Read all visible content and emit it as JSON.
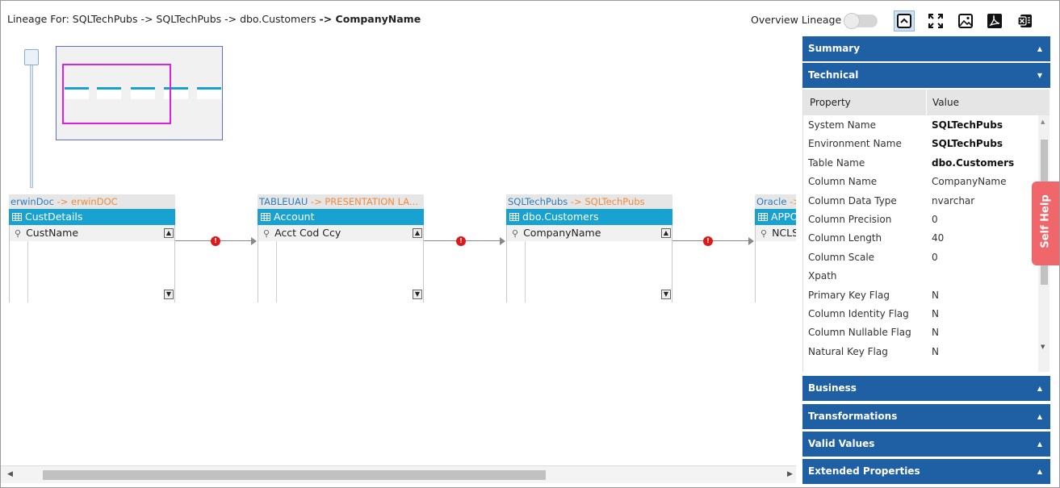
{
  "header": {
    "title_prefix": "Lineage For: SQLTechPubs -> SQLTechPubs -> dbo.Customers ",
    "title_current": "-> CompanyName",
    "overview_label": "Overview Lineage",
    "overview_enabled": false,
    "toolbar_icons": [
      "collapse-icon",
      "fullscreen-icon",
      "image-export-icon",
      "pdf-export-icon",
      "excel-export-icon"
    ]
  },
  "nodes": [
    {
      "source": "erwinDoc",
      "sep": " -> ",
      "target": "erwinDOC",
      "table": "CustDetails",
      "column": "CustName"
    },
    {
      "source": "TABLEUAU",
      "sep": " -> ",
      "target": "PRESENTATION LA...",
      "table": "Account",
      "column": "Acct Cod Ccy"
    },
    {
      "source": "SQLTechPubs",
      "sep": " -> ",
      "target": "SQLTechPubs",
      "table": "dbo.Customers",
      "column": "CompanyName"
    },
    {
      "source": "Oracle",
      "sep": " -> ",
      "target": "",
      "table": "APPO",
      "column": "NCLS"
    }
  ],
  "connector_badge": "!",
  "panel": {
    "summary": "Summary",
    "technical": "Technical",
    "business": "Business",
    "transformations": "Transformations",
    "valid_values": "Valid Values",
    "extended_properties": "Extended Properties",
    "col_property": "Property",
    "col_value": "Value",
    "rows": [
      {
        "name": "System Name",
        "value": "SQLTechPubs"
      },
      {
        "name": "Environment Name",
        "value": "SQLTechPubs"
      },
      {
        "name": "Table Name",
        "value": "dbo.Customers"
      },
      {
        "name": "Column Name",
        "value": "CompanyName"
      },
      {
        "name": "Column Data Type",
        "value": "nvarchar"
      },
      {
        "name": "Column Precision",
        "value": "0"
      },
      {
        "name": "Column Length",
        "value": "40"
      },
      {
        "name": "Column Scale",
        "value": "0"
      },
      {
        "name": "Xpath",
        "value": ""
      },
      {
        "name": "Primary Key Flag",
        "value": "N"
      },
      {
        "name": "Column Identity Flag",
        "value": "N"
      },
      {
        "name": "Column Nullable Flag",
        "value": "N"
      },
      {
        "name": "Natural Key Flag",
        "value": "N"
      }
    ]
  },
  "self_help": "Self Help",
  "colors": {
    "panel_header": "#1f5fa3",
    "table_header": "#18a2d2",
    "source_highlight": "#f08a3c",
    "badge": "#e01818",
    "self_help": "#f0676b"
  }
}
